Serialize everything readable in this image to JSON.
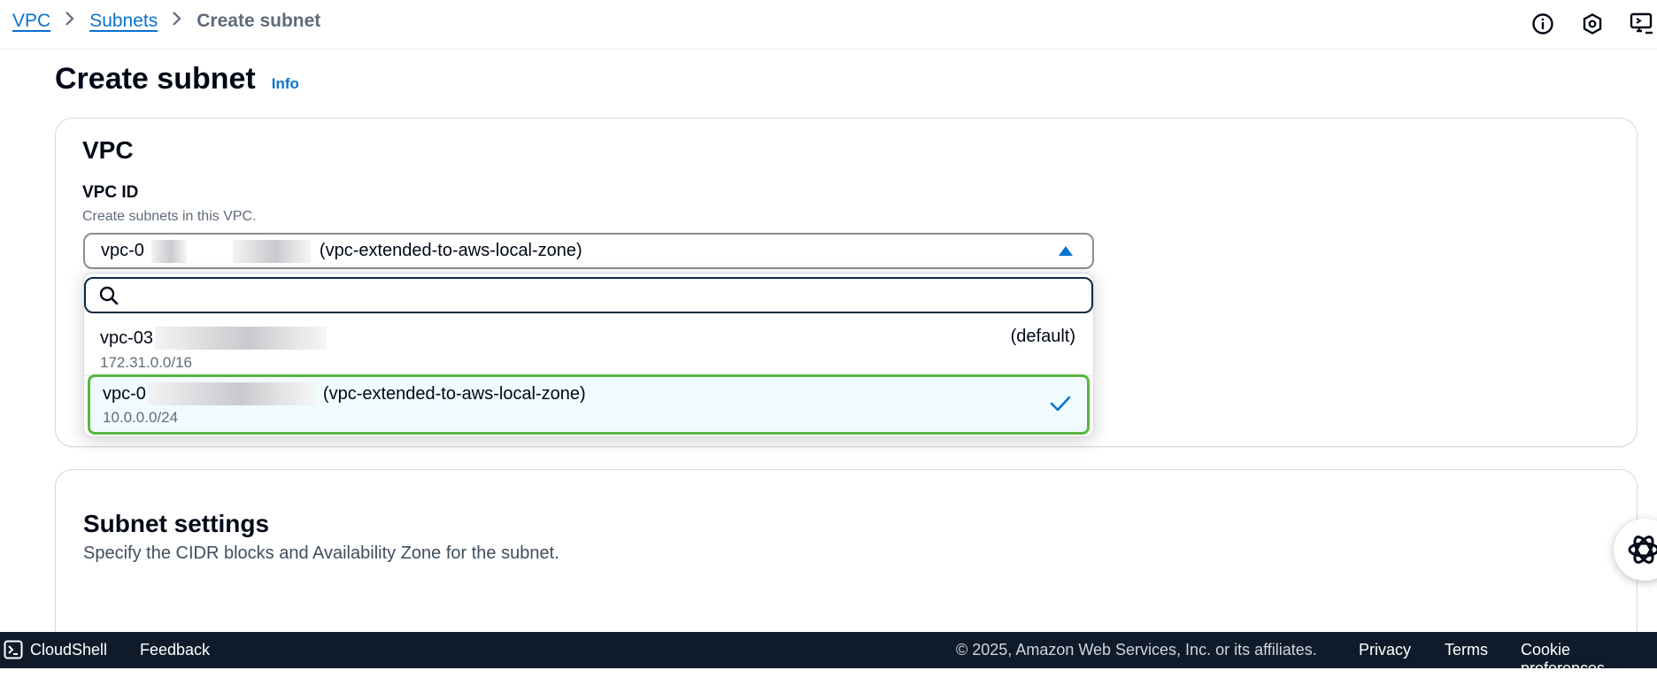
{
  "breadcrumb": {
    "items": [
      "VPC",
      "Subnets"
    ],
    "current": "Create subnet"
  },
  "header": {
    "title": "Create subnet",
    "info_label": "Info"
  },
  "vpc_section": {
    "title": "VPC",
    "field_label": "VPC ID",
    "field_description": "Create subnets in this VPC.",
    "selected": {
      "id_prefix": "vpc-0",
      "name": "(vpc-extended-to-aws-local-zone)"
    },
    "search_placeholder": "",
    "options": [
      {
        "id_prefix": "vpc-03",
        "cidr": "172.31.0.0/16",
        "tag": "(default)",
        "selected": false
      },
      {
        "id_prefix": "vpc-0",
        "name": "(vpc-extended-to-aws-local-zone)",
        "cidr": "10.0.0.0/24",
        "selected": true
      }
    ]
  },
  "subnet_section": {
    "title": "Subnet settings",
    "description": "Specify the CIDR blocks and Availability Zone for the subnet."
  },
  "footer": {
    "cloudshell": "CloudShell",
    "feedback": "Feedback",
    "copyright": "© 2025, Amazon Web Services, Inc. or its affiliates.",
    "privacy": "Privacy",
    "terms": "Terms",
    "cookies": "Cookie preferences"
  },
  "colors": {
    "link": "#0972d3",
    "selected_border": "#5ab53e",
    "selected_bg": "#f0fbff",
    "footer_bg": "#0f1b2a"
  },
  "icons": [
    "info-circle-icon",
    "notifications-icon",
    "feedback-screen-icon",
    "search-icon",
    "check-icon",
    "cloudshell-icon",
    "ai-assistant-icon",
    "caret-up-icon",
    "chevron-right-icon"
  ]
}
